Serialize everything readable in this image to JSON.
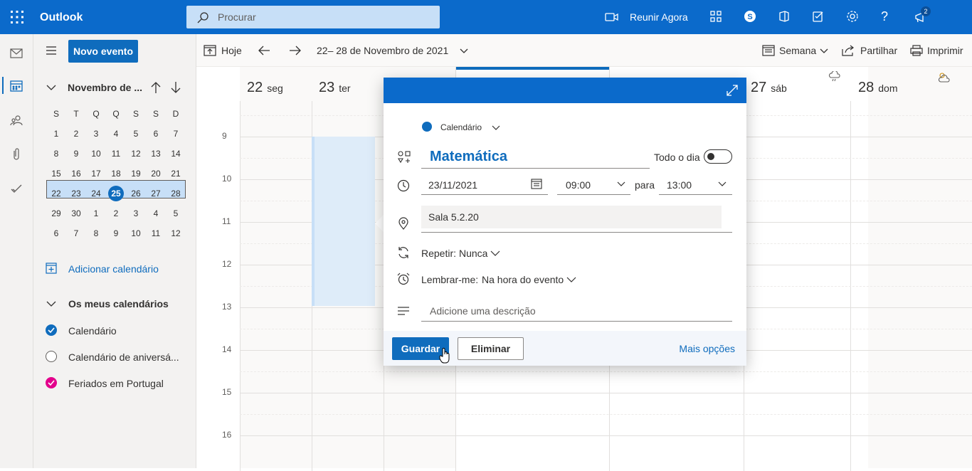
{
  "app": {
    "name": "Outlook",
    "accent": "#0f6cbd"
  },
  "search": {
    "placeholder": "Procurar"
  },
  "topbar": {
    "meet_now": "Reunir Agora",
    "notification_count": "2"
  },
  "sidebar": {
    "new_event": "Novo evento",
    "month_title": "Novembro de ...",
    "weekday_headers": [
      "S",
      "T",
      "Q",
      "Q",
      "S",
      "S",
      "D"
    ],
    "weeks": [
      [
        "1",
        "2",
        "3",
        "4",
        "5",
        "6",
        "7"
      ],
      [
        "8",
        "9",
        "10",
        "11",
        "12",
        "13",
        "14"
      ],
      [
        "15",
        "16",
        "17",
        "18",
        "19",
        "20",
        "21"
      ],
      [
        "22",
        "23",
        "24",
        "25",
        "26",
        "27",
        "28"
      ],
      [
        "29",
        "30",
        "1",
        "2",
        "3",
        "4",
        "5"
      ],
      [
        "6",
        "7",
        "8",
        "9",
        "10",
        "11",
        "12"
      ]
    ],
    "today": "25",
    "add_calendar": "Adicionar calendário",
    "my_calendars_header": "Os meus calendários",
    "calendars": [
      {
        "name": "Calendário",
        "color": "#0f6cbd",
        "checked": true
      },
      {
        "name": "Calendário de aniversá...",
        "color": "#ffffff",
        "checked": false
      },
      {
        "name": "Feriados em Portugal",
        "color": "#e3008c",
        "checked": true
      }
    ]
  },
  "toolbar": {
    "today": "Hoje",
    "range": "22– 28 de Novembro de 2021",
    "view": "Semana",
    "share": "Partilhar",
    "print": "Imprimir"
  },
  "week": {
    "days": [
      {
        "num": "22",
        "name": "seg"
      },
      {
        "num": "23",
        "name": "ter"
      },
      {
        "num": "27",
        "name": "sáb"
      },
      {
        "num": "28",
        "name": "dom"
      }
    ],
    "hours": [
      "9",
      "10",
      "11",
      "12",
      "13",
      "14",
      "15",
      "16"
    ]
  },
  "event_popup": {
    "calendar": "Calendário",
    "title": "Matemática",
    "all_day": "Todo o dia",
    "date": "23/11/2021",
    "start": "09:00",
    "to": "para",
    "end": "13:00",
    "location": "Sala 5.2.20",
    "repeat_label": "Repetir:",
    "repeat_value": "Nunca",
    "remind_label": "Lembrar-me:",
    "remind_value": "Na hora do evento",
    "description_placeholder": "Adicione uma descrição",
    "save": "Guardar",
    "delete": "Eliminar",
    "more_options": "Mais opções"
  }
}
